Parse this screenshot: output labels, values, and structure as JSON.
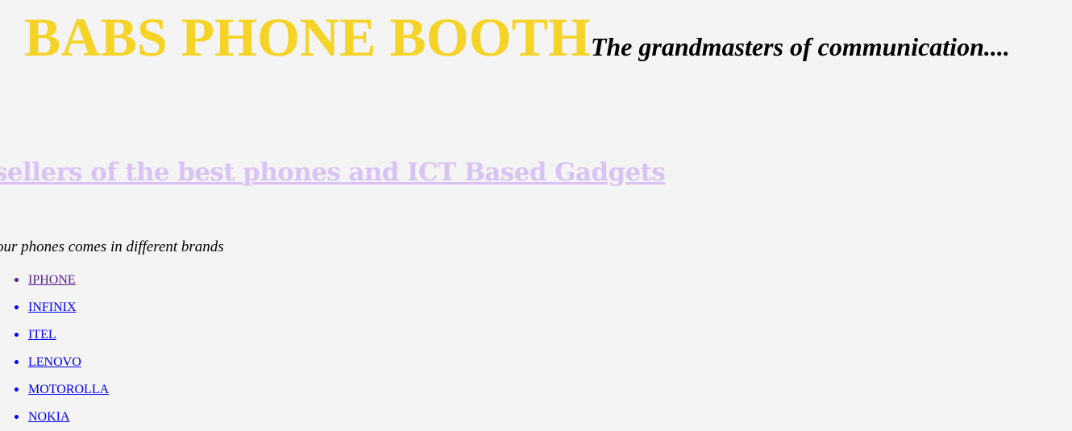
{
  "header": {
    "title": "BABS PHONE BOOTH",
    "tagline": "The grandmasters of communication...."
  },
  "subheading": "sellers of the best phones and ICT Based Gadgets",
  "intro": "our phones comes in different brands",
  "brands": [
    {
      "label": "IPHONE",
      "visited": true
    },
    {
      "label": "INFINIX",
      "visited": false
    },
    {
      "label": "ITEL",
      "visited": false
    },
    {
      "label": "LENOVO",
      "visited": false
    },
    {
      "label": "MOTOROLLA",
      "visited": false
    },
    {
      "label": "NOKIA",
      "visited": false
    }
  ],
  "colors": {
    "title": "#f5d327",
    "subheading": "#d9c3f5",
    "link": "#0000ee",
    "visited_link": "#551a8b",
    "background": "#f4f4f4"
  }
}
